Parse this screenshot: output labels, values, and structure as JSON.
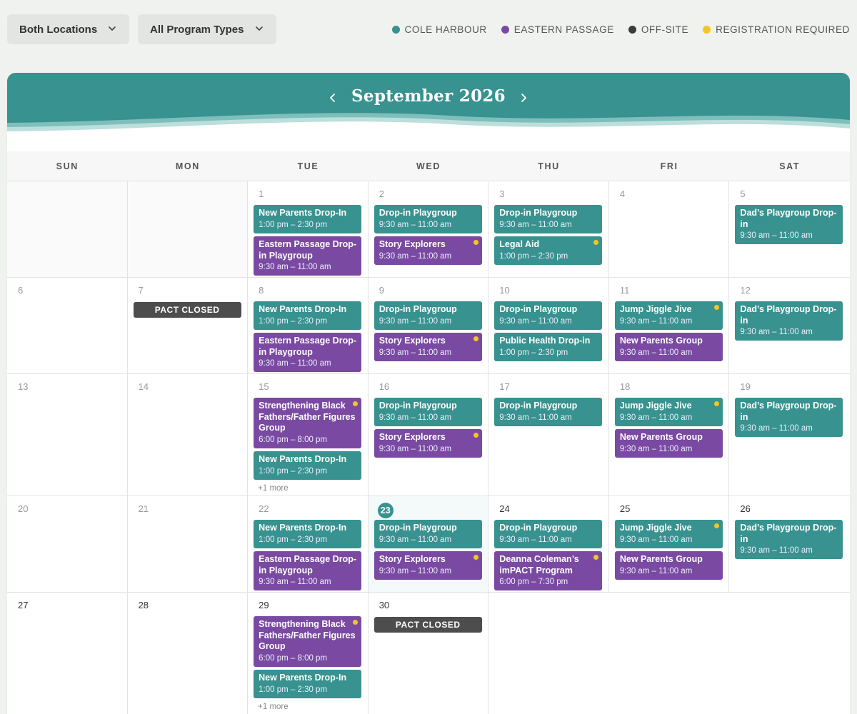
{
  "filters": {
    "location": "Both Locations",
    "program_type": "All Program Types"
  },
  "legend": [
    {
      "label": "COLE HARBOUR",
      "color": "#38928f"
    },
    {
      "label": "EASTERN PASSAGE",
      "color": "#7a4aa2"
    },
    {
      "label": "OFF-SITE",
      "color": "#3b3b3b"
    },
    {
      "label": "REGISTRATION REQUIRED",
      "color": "#f3c623"
    }
  ],
  "calendar": {
    "month_label": "September 2026",
    "weekdays": [
      "SUN",
      "MON",
      "TUE",
      "WED",
      "THU",
      "FRI",
      "SAT"
    ],
    "weeks": [
      [
        null,
        null,
        {
          "day": "1",
          "events": [
            {
              "title": "New Parents Drop-In",
              "time": "1:00 pm – 2:30 pm",
              "loc": "ch"
            },
            {
              "title": "Eastern Passage Drop-in Playgroup",
              "time": "9:30 am – 11:00 am",
              "loc": "ep"
            }
          ]
        },
        {
          "day": "2",
          "events": [
            {
              "title": "Drop-in Playgroup",
              "time": "9:30 am – 11:00 am",
              "loc": "ch"
            },
            {
              "title": "Story Explorers",
              "time": "9:30 am – 11:00 am",
              "loc": "ep",
              "reg": true
            }
          ]
        },
        {
          "day": "3",
          "events": [
            {
              "title": "Drop-in Playgroup",
              "time": "9:30 am – 11:00 am",
              "loc": "ch"
            },
            {
              "title": "Legal Aid",
              "time": "1:00 pm – 2:30 pm",
              "loc": "ch",
              "reg": true
            }
          ]
        },
        {
          "day": "4",
          "events": []
        },
        {
          "day": "5",
          "events": [
            {
              "title": "Dad’s Playgroup Drop-in",
              "time": "9:30 am – 11:00 am",
              "loc": "ch"
            }
          ]
        }
      ],
      [
        {
          "day": "6",
          "events": []
        },
        {
          "day": "7",
          "closed": "PACT CLOSED",
          "events": []
        },
        {
          "day": "8",
          "events": [
            {
              "title": "New Parents Drop-In",
              "time": "1:00 pm – 2:30 pm",
              "loc": "ch"
            },
            {
              "title": "Eastern Passage Drop-in Playgroup",
              "time": "9:30 am – 11:00 am",
              "loc": "ep"
            }
          ]
        },
        {
          "day": "9",
          "events": [
            {
              "title": "Drop-in Playgroup",
              "time": "9:30 am – 11:00 am",
              "loc": "ch"
            },
            {
              "title": "Story Explorers",
              "time": "9:30 am – 11:00 am",
              "loc": "ep",
              "reg": true
            }
          ]
        },
        {
          "day": "10",
          "events": [
            {
              "title": "Drop-in Playgroup",
              "time": "9:30 am – 11:00 am",
              "loc": "ch"
            },
            {
              "title": "Public Health Drop-in",
              "time": "1:00 pm – 2:30 pm",
              "loc": "ch"
            }
          ]
        },
        {
          "day": "11",
          "events": [
            {
              "title": "Jump Jiggle Jive",
              "time": "9:30 am – 11:00 am",
              "loc": "ch",
              "reg": true
            },
            {
              "title": "New Parents Group",
              "time": "9:30 am – 11:00 am",
              "loc": "ep"
            }
          ]
        },
        {
          "day": "12",
          "events": [
            {
              "title": "Dad’s Playgroup Drop-in",
              "time": "9:30 am – 11:00 am",
              "loc": "ch"
            }
          ]
        }
      ],
      [
        {
          "day": "13",
          "events": []
        },
        {
          "day": "14",
          "events": []
        },
        {
          "day": "15",
          "more": "+1 more",
          "events": [
            {
              "title": "Strengthening Black Fathers/Father Figures Group",
              "time": "6:00 pm – 8:00 pm",
              "loc": "ep",
              "reg": true
            },
            {
              "title": "New Parents Drop-In",
              "time": "1:00 pm – 2:30 pm",
              "loc": "ch"
            }
          ]
        },
        {
          "day": "16",
          "events": [
            {
              "title": "Drop-in Playgroup",
              "time": "9:30 am – 11:00 am",
              "loc": "ch"
            },
            {
              "title": "Story Explorers",
              "time": "9:30 am – 11:00 am",
              "loc": "ep",
              "reg": true
            }
          ]
        },
        {
          "day": "17",
          "events": [
            {
              "title": "Drop-in Playgroup",
              "time": "9:30 am – 11:00 am",
              "loc": "ch"
            }
          ]
        },
        {
          "day": "18",
          "events": [
            {
              "title": "Jump Jiggle Jive",
              "time": "9:30 am – 11:00 am",
              "loc": "ch",
              "reg": true
            },
            {
              "title": "New Parents Group",
              "time": "9:30 am – 11:00 am",
              "loc": "ep"
            }
          ]
        },
        {
          "day": "19",
          "events": [
            {
              "title": "Dad’s Playgroup Drop-in",
              "time": "9:30 am – 11:00 am",
              "loc": "ch"
            }
          ]
        }
      ],
      [
        {
          "day": "20",
          "events": []
        },
        {
          "day": "21",
          "events": []
        },
        {
          "day": "22",
          "events": [
            {
              "title": "New Parents Drop-In",
              "time": "1:00 pm – 2:30 pm",
              "loc": "ch"
            },
            {
              "title": "Eastern Passage Drop-in Playgroup",
              "time": "9:30 am – 11:00 am",
              "loc": "ep"
            }
          ]
        },
        {
          "day": "23",
          "today": true,
          "events": [
            {
              "title": "Drop-in Playgroup",
              "time": "9:30 am – 11:00 am",
              "loc": "ch"
            },
            {
              "title": "Story Explorers",
              "time": "9:30 am – 11:00 am",
              "loc": "ep",
              "reg": true
            }
          ]
        },
        {
          "day": "24",
          "events": [
            {
              "title": "Drop-in Playgroup",
              "time": "9:30 am – 11:00 am",
              "loc": "ch"
            },
            {
              "title": "Deanna Coleman’s imPACT Program",
              "time": "6:00 pm – 7:30 pm",
              "loc": "ep",
              "reg": true
            }
          ]
        },
        {
          "day": "25",
          "events": [
            {
              "title": "Jump Jiggle Jive",
              "time": "9:30 am – 11:00 am",
              "loc": "ch",
              "reg": true
            },
            {
              "title": "New Parents Group",
              "time": "9:30 am – 11:00 am",
              "loc": "ep"
            }
          ]
        },
        {
          "day": "26",
          "events": [
            {
              "title": "Dad’s Playgroup Drop-in",
              "time": "9:30 am – 11:00 am",
              "loc": "ch"
            }
          ]
        }
      ],
      [
        {
          "day": "27",
          "events": []
        },
        {
          "day": "28",
          "events": []
        },
        {
          "day": "29",
          "more": "+1 more",
          "events": [
            {
              "title": "Strengthening Black Fathers/Father Figures Group",
              "time": "6:00 pm – 8:00 pm",
              "loc": "ep",
              "reg": true
            },
            {
              "title": "New Parents Drop-In",
              "time": "1:00 pm – 2:30 pm",
              "loc": "ch"
            }
          ]
        },
        {
          "day": "30",
          "closed": "PACT CLOSED",
          "events": []
        },
        null,
        null,
        null
      ]
    ]
  }
}
